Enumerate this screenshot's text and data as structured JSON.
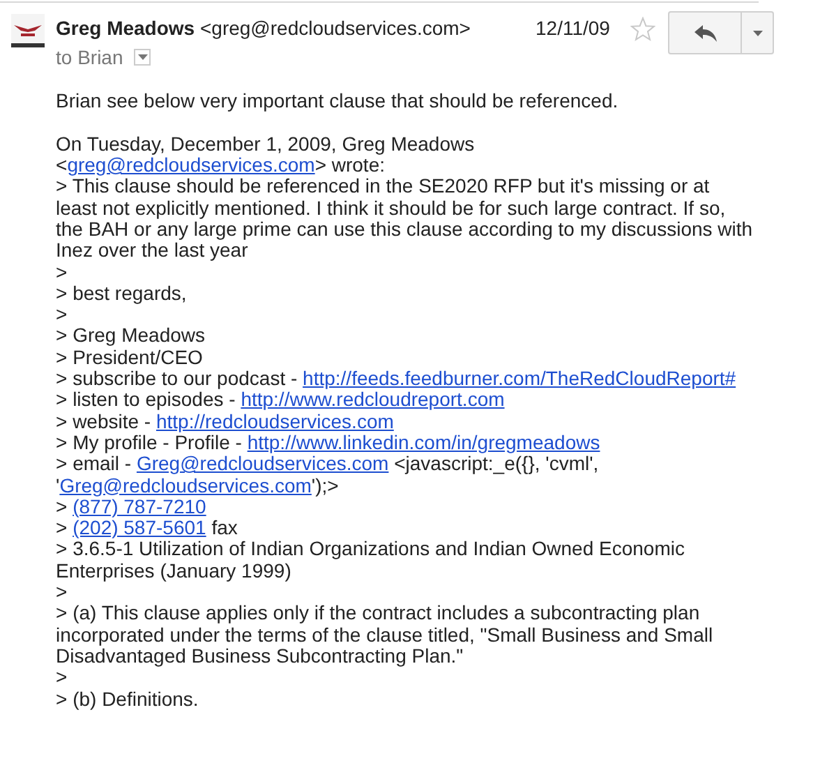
{
  "header": {
    "sender_name": "Greg Meadows",
    "sender_email": "<greg@redcloudservices.com>",
    "recipients": "to Brian",
    "date": "12/11/09",
    "starred": false
  },
  "body": [
    [
      [
        {
          "kind": "text",
          "text": "Brian see below very important clause that should be referenced."
        }
      ]
    ],
    [
      [
        {
          "kind": "text",
          "text": "On Tuesday, December 1, 2009, Greg Meadows"
        }
      ],
      [
        {
          "kind": "text",
          "text": "<"
        },
        {
          "kind": "link",
          "text": "greg@redcloudservices.com"
        },
        {
          "kind": "text",
          "text": "> wrote:"
        }
      ],
      [
        {
          "kind": "text",
          "text": "> This clause should be referenced in the SE2020 RFP but it's missing or at"
        }
      ],
      [
        {
          "kind": "text",
          "text": "least not explicitly mentioned. I think it should be for such large contract. If so,"
        }
      ],
      [
        {
          "kind": "text",
          "text": "the BAH or any large prime can use this clause according to my discussions with"
        }
      ],
      [
        {
          "kind": "text",
          "text": "Inez over the last year"
        }
      ],
      [
        {
          "kind": "text",
          "text": ">"
        }
      ],
      [
        {
          "kind": "text",
          "text": "> best regards,"
        }
      ],
      [
        {
          "kind": "text",
          "text": ">"
        }
      ],
      [
        {
          "kind": "text",
          "text": "> Greg Meadows"
        }
      ],
      [
        {
          "kind": "text",
          "text": "> President/CEO"
        }
      ],
      [
        {
          "kind": "text",
          "text": "> subscribe to our podcast - "
        },
        {
          "kind": "link",
          "text": "http://feeds.feedburner.com/TheRedCloudReport#"
        }
      ],
      [
        {
          "kind": "text",
          "text": "> listen to episodes - "
        },
        {
          "kind": "link",
          "text": "http://www.redcloudreport.com"
        }
      ],
      [
        {
          "kind": "text",
          "text": "> website - "
        },
        {
          "kind": "link",
          "text": "http://redcloudservices.com"
        }
      ],
      [
        {
          "kind": "text",
          "text": "> My profile - Profile - "
        },
        {
          "kind": "link",
          "text": "http://www.linkedin.com/in/gregmeadows"
        }
      ],
      [
        {
          "kind": "text",
          "text": "> email - "
        },
        {
          "kind": "link",
          "text": "Greg@redcloudservices.com"
        },
        {
          "kind": "text",
          "text": " <javascript:_e({}, 'cvml',"
        }
      ],
      [
        {
          "kind": "text",
          "text": "'"
        },
        {
          "kind": "link",
          "text": "Greg@redcloudservices.com"
        },
        {
          "kind": "text",
          "text": "');>"
        }
      ],
      [
        {
          "kind": "text",
          "text": "> "
        },
        {
          "kind": "link",
          "text": "(877) 787-7210"
        }
      ],
      [
        {
          "kind": "text",
          "text": "> "
        },
        {
          "kind": "link",
          "text": "(202) 587-5601"
        },
        {
          "kind": "text",
          "text": " fax"
        }
      ],
      [
        {
          "kind": "text",
          "text": "> 3.6.5-1 Utilization of Indian Organizations and Indian Owned Economic"
        }
      ],
      [
        {
          "kind": "text",
          "text": "Enterprises (January 1999)"
        }
      ],
      [
        {
          "kind": "text",
          "text": ">"
        }
      ],
      [
        {
          "kind": "text",
          "text": "> (a) This clause applies only if the contract includes a subcontracting plan"
        }
      ],
      [
        {
          "kind": "text",
          "text": "incorporated under the terms of the clause titled, \"Small Business and Small"
        }
      ],
      [
        {
          "kind": "text",
          "text": "Disadvantaged Business Subcontracting Plan.\""
        }
      ],
      [
        {
          "kind": "text",
          "text": ">"
        }
      ],
      [
        {
          "kind": "text",
          "text": "> (b) Definitions."
        }
      ]
    ]
  ]
}
